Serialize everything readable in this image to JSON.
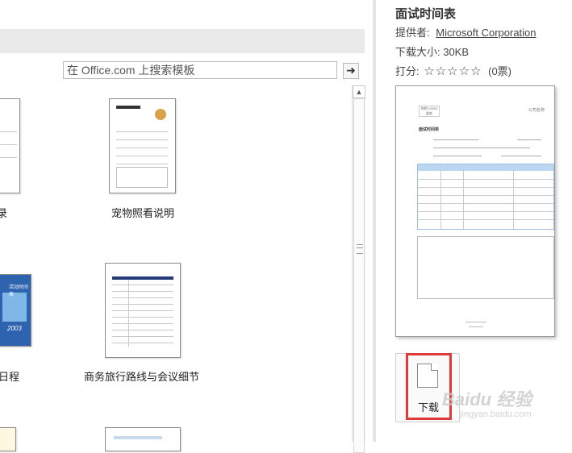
{
  "search": {
    "placeholder": "在 Office.com 上搜索模板",
    "go_symbol": "➜"
  },
  "templates": [
    {
      "label": "录"
    },
    {
      "label": "宠物照看说明"
    },
    {
      "label": "日程"
    },
    {
      "label": "商务旅行路线与会议细节"
    }
  ],
  "poster": {
    "text_1": "活动时间表",
    "text_2": "2003"
  },
  "details": {
    "title": "面试时间表",
    "provider_label": "提供者:",
    "provider_name": "Microsoft Corporation",
    "size": "下载大小: 30KB",
    "rating_label": "打分:",
    "stars": "☆☆☆☆☆",
    "votes": "(0票)"
  },
  "preview": {
    "logo_text": "你的 LOGO 此处",
    "company": "公司名称",
    "heading": "面试时间表"
  },
  "download": {
    "label": "下载"
  },
  "watermark": {
    "text": "Baidu 经验",
    "sub": "jingyan.baidu.com"
  },
  "colors": {
    "highlight": "#e03a3a",
    "link": "#333333",
    "poster_bg": "#2e63b0"
  }
}
